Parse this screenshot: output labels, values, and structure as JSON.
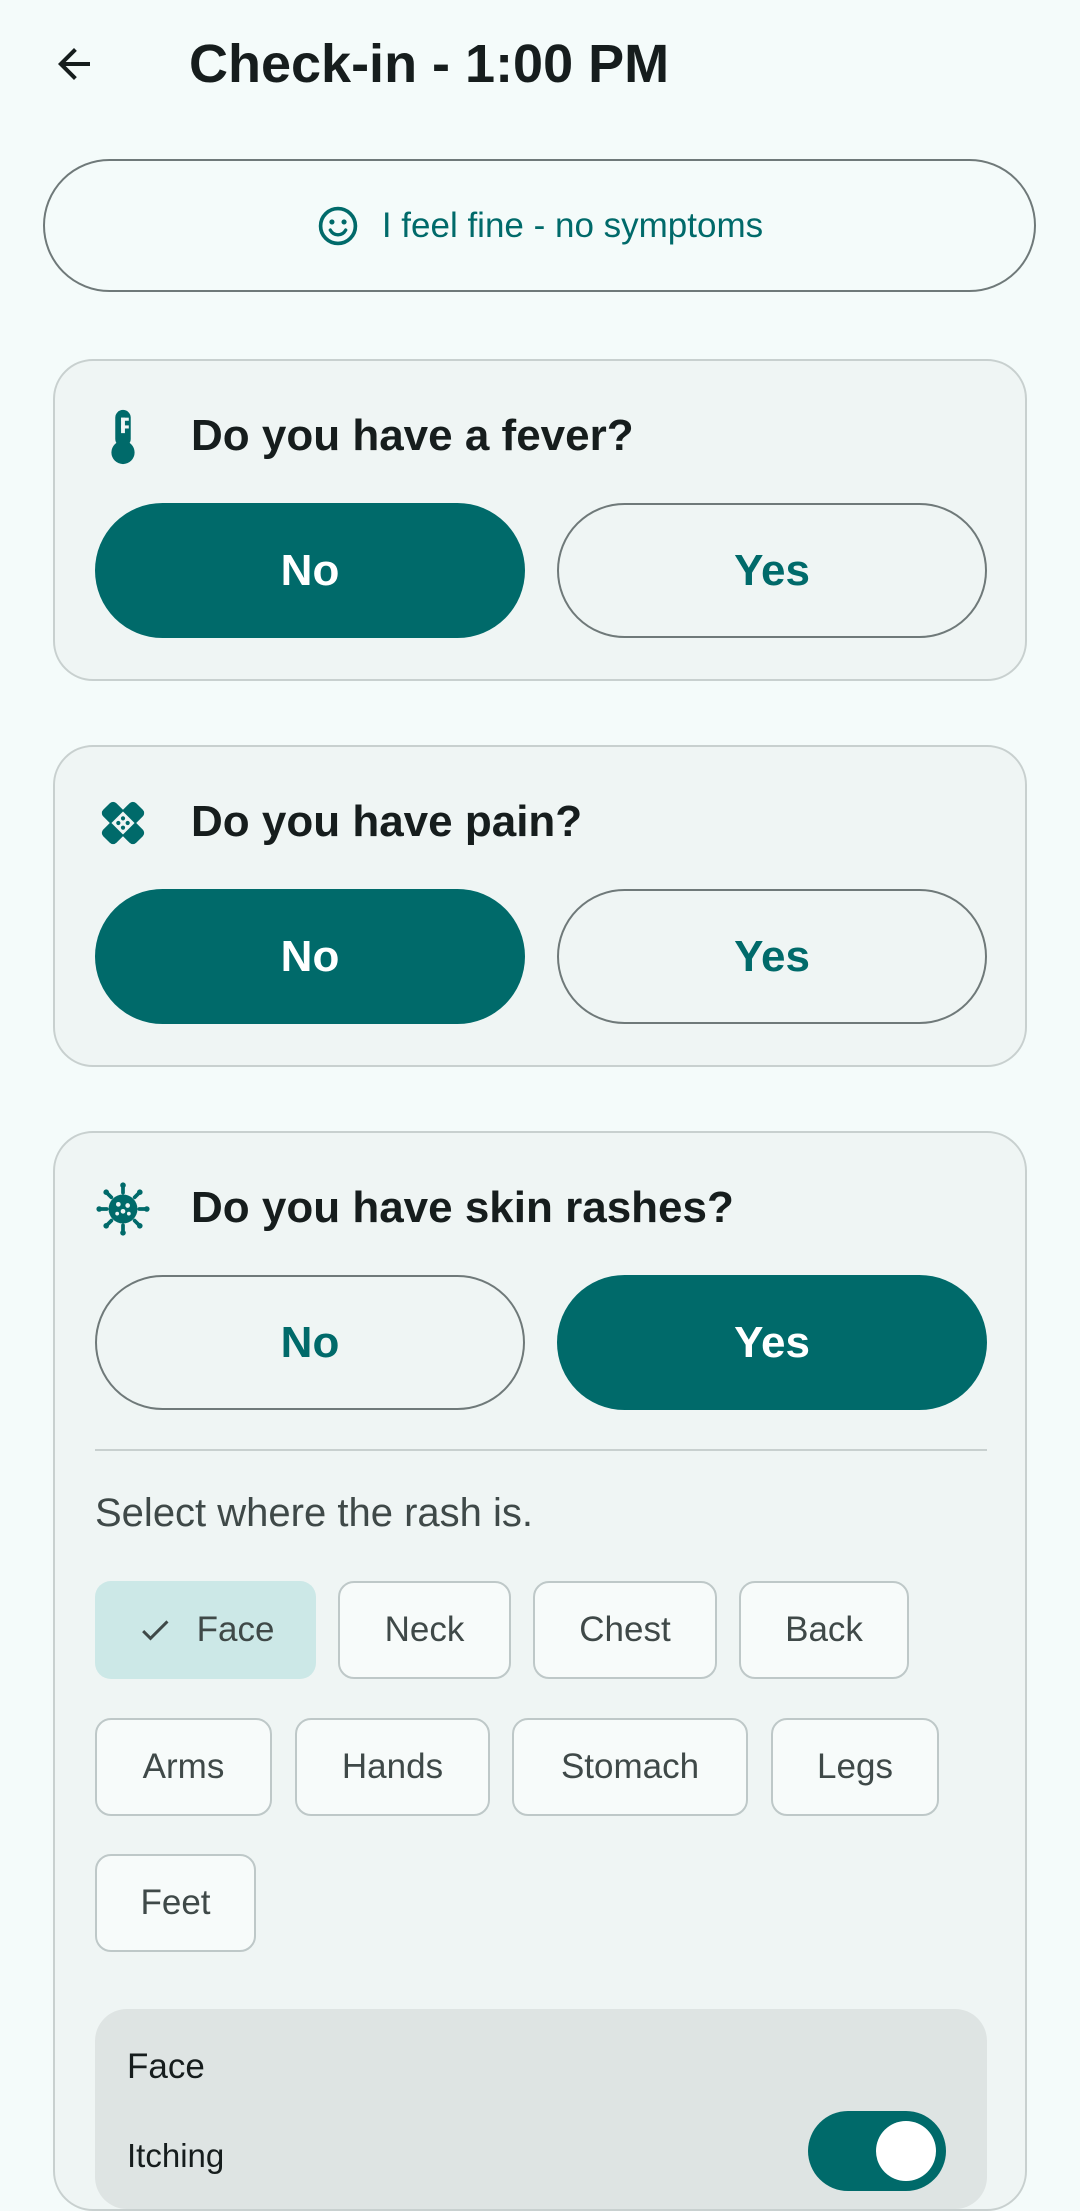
{
  "header": {
    "title": "Check-in - 1:00 PM"
  },
  "fine_button": {
    "label": "I feel fine - no symptoms",
    "icon": "smile-icon"
  },
  "questions": [
    {
      "icon": "thermometer-icon",
      "text": "Do you have a fever?",
      "options": [
        "No",
        "Yes"
      ],
      "selected": "No"
    },
    {
      "icon": "bandage-icon",
      "text": "Do you have pain?",
      "options": [
        "No",
        "Yes"
      ],
      "selected": "No"
    },
    {
      "icon": "virus-icon",
      "text": "Do you have skin rashes?",
      "options": [
        "No",
        "Yes"
      ],
      "selected": "Yes"
    }
  ],
  "rash": {
    "hint": "Select where the rash is.",
    "locations": [
      "Face",
      "Neck",
      "Chest",
      "Back",
      "Arms",
      "Hands",
      "Stomach",
      "Legs",
      "Feet"
    ],
    "selected": [
      "Face"
    ],
    "detail": {
      "title": "Face",
      "item_label": "Itching",
      "item_on": true
    }
  },
  "colors": {
    "primary": "#006a6a",
    "background": "#f4fbfa",
    "card": "#eff5f4",
    "chip_selected": "#cce8e7",
    "outline": "#6f7979"
  }
}
